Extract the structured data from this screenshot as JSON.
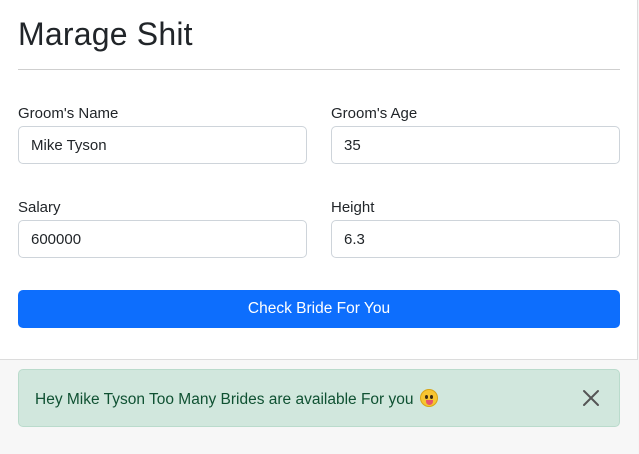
{
  "header": {
    "title": "Marage Shit"
  },
  "form": {
    "groom_name": {
      "label": "Groom's Name",
      "value": "Mike Tyson"
    },
    "groom_age": {
      "label": "Groom's Age",
      "value": "35"
    },
    "salary": {
      "label": "Salary",
      "value": "600000"
    },
    "height": {
      "label": "Height",
      "value": "6.3"
    },
    "submit_label": "Check Bride For You"
  },
  "alert": {
    "message": "Hey Mike Tyson Too Many Brides are available For you",
    "emoji_icon": "face-with-tongue-icon",
    "close_icon": "close-icon"
  },
  "colors": {
    "primary": "#0d6efd",
    "alert_bg": "#d1e7dd",
    "alert_text": "#0f5132"
  }
}
